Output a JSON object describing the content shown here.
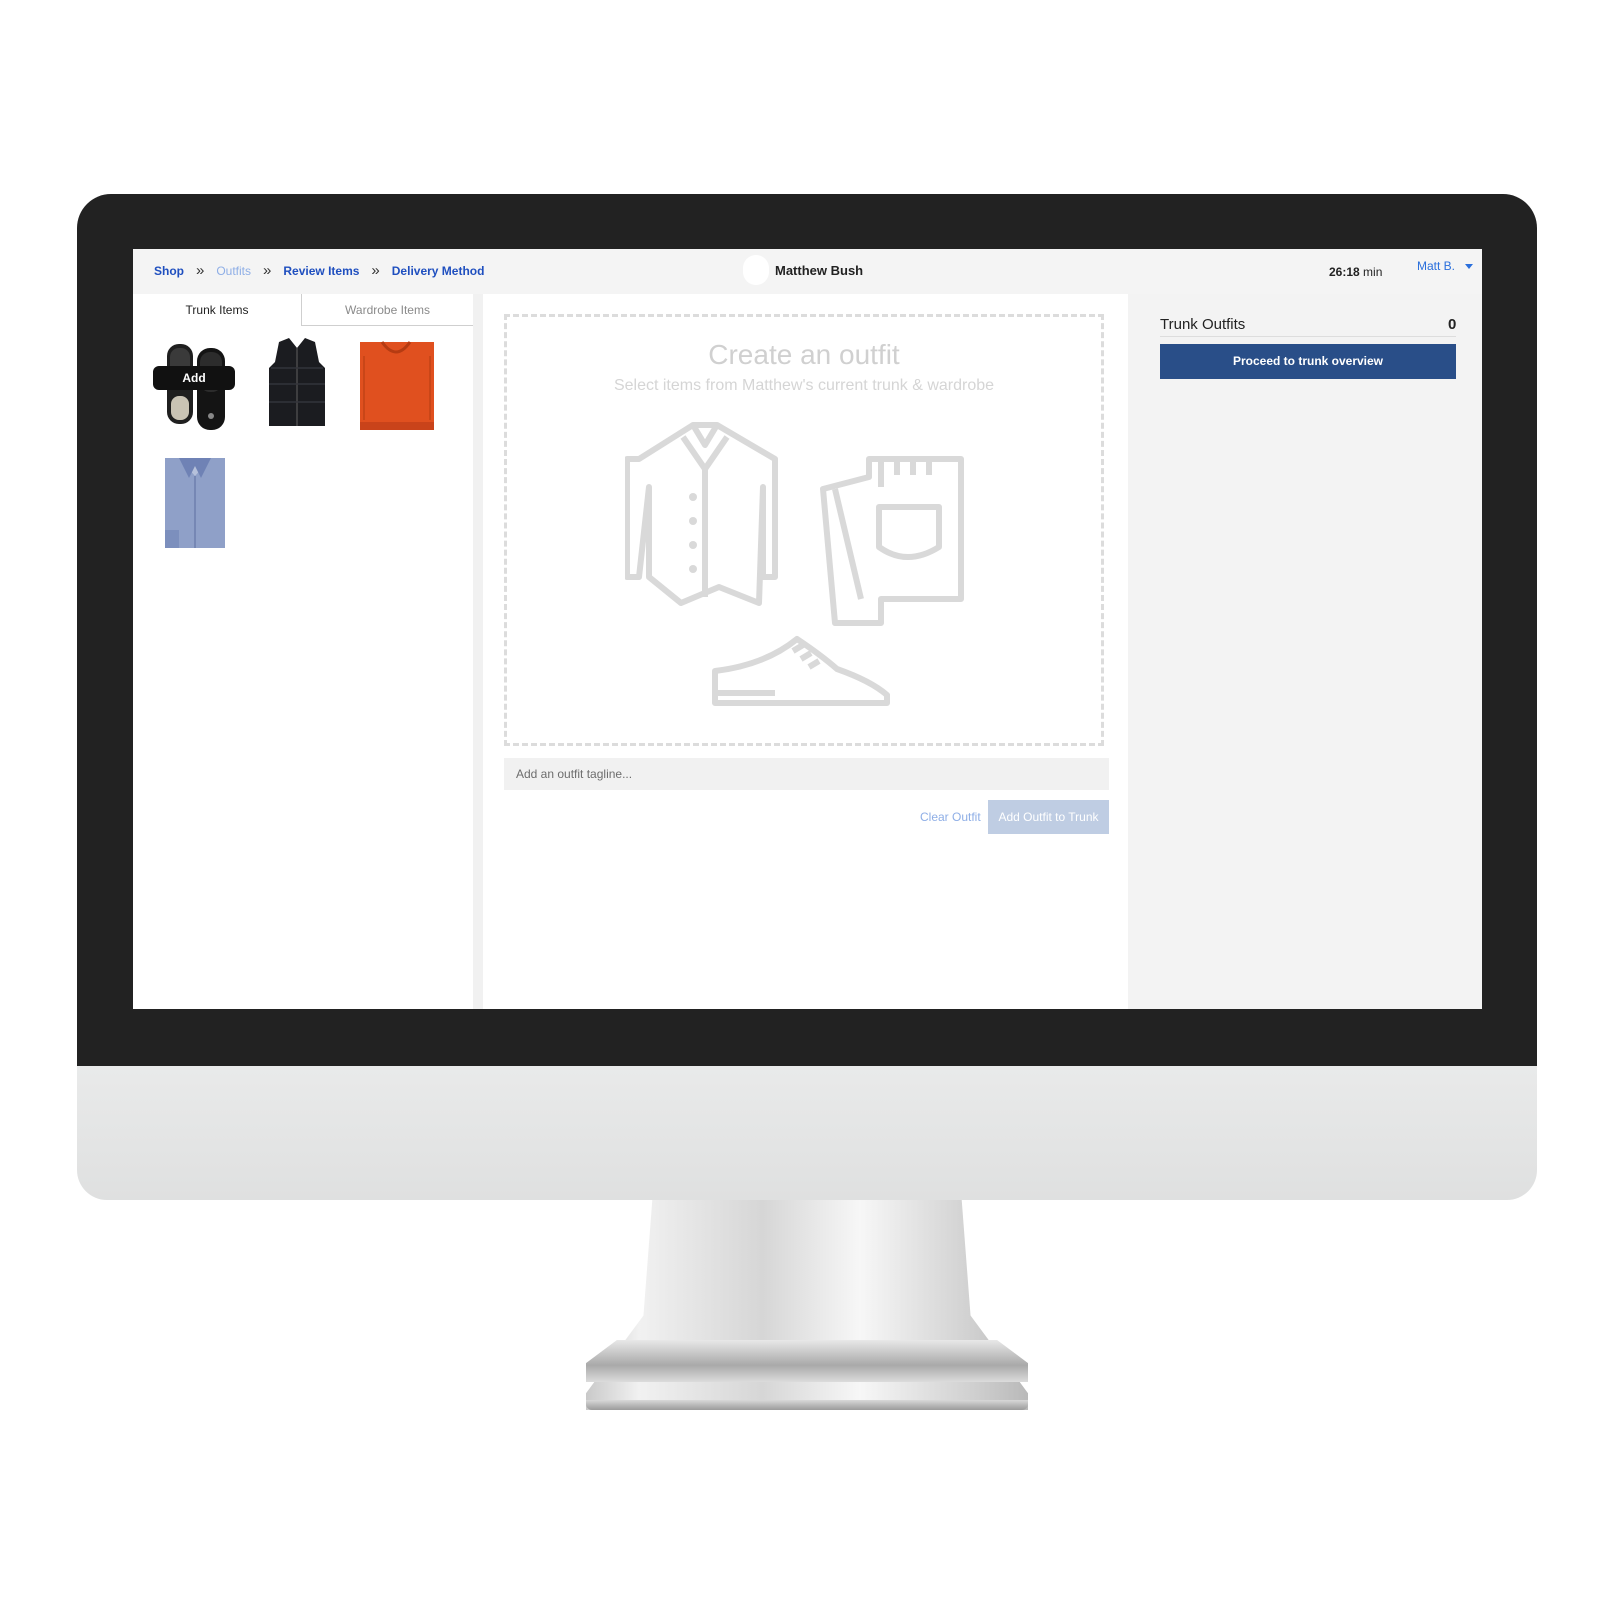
{
  "breadcrumbs": [
    {
      "label": "Shop",
      "state": "active"
    },
    {
      "label": "Outfits",
      "state": "current"
    },
    {
      "label": "Review Items",
      "state": "active"
    },
    {
      "label": "Delivery Method",
      "state": "active"
    }
  ],
  "breadcrumb_separator": "»",
  "client": {
    "name": "Matthew Bush"
  },
  "timer": {
    "value": "26:18",
    "unit": "min"
  },
  "user_menu": {
    "label": "Matt B."
  },
  "left_tabs": [
    {
      "label": "Trunk Items",
      "active": true
    },
    {
      "label": "Wardrobe Items",
      "active": false
    }
  ],
  "items": [
    {
      "icon": "sneakers-icon"
    },
    {
      "icon": "puffer-vest-icon"
    },
    {
      "icon": "orange-sweater-icon"
    },
    {
      "icon": "dress-shirt-icon"
    }
  ],
  "add_label": "Add",
  "outfit_builder": {
    "title": "Create an outfit",
    "subtitle": "Select items from Matthew's current trunk & wardrobe",
    "tagline_placeholder": "Add an outfit tagline...",
    "clear_label": "Clear Outfit",
    "add_label": "Add Outfit to Trunk"
  },
  "trunk_outfits": {
    "title": "Trunk Outfits",
    "count": "0",
    "proceed_label": "Proceed to trunk overview"
  },
  "colors": {
    "link": "#1f4fbf",
    "primary_button": "#294e88",
    "disabled_button": "#bfcde3",
    "placeholder_icon": "#d9d9d9"
  }
}
